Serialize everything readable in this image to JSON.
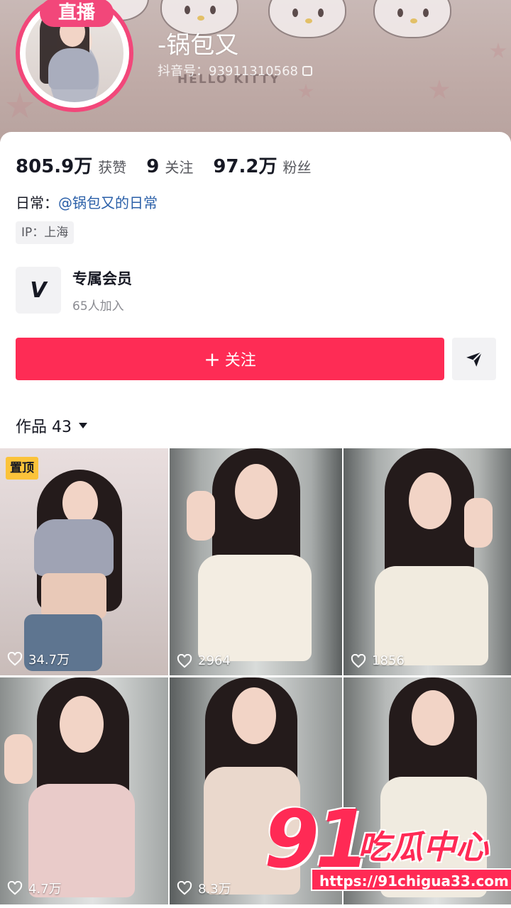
{
  "profile": {
    "live_badge": "直播",
    "username": "-锅包又",
    "douyin_id": "抖音号：93911310568",
    "banner_text": "HELLO KITTY"
  },
  "stats": [
    {
      "value": "805.9万",
      "label": "获赞"
    },
    {
      "value": "9",
      "label": "关注"
    },
    {
      "value": "97.2万",
      "label": "粉丝"
    }
  ],
  "bio": {
    "prefix": "日常：",
    "link": "@锅包又的日常"
  },
  "ip": "IP：上海",
  "member": {
    "icon_glyph": "V",
    "title": "专属会员",
    "subtitle": "65人加入"
  },
  "actions": {
    "follow_plus": "+",
    "follow_label": "关注",
    "share_icon": "send-icon"
  },
  "works_tab": {
    "label": "作品 43"
  },
  "videos": [
    {
      "pinned": "置顶",
      "likes": "34.7万"
    },
    {
      "likes": "2964"
    },
    {
      "likes": "1856"
    },
    {
      "likes": "4.7万"
    },
    {
      "likes": "8.3万"
    },
    {
      "likes": ""
    }
  ],
  "watermark": {
    "big": "91",
    "cn": "吃瓜中心",
    "url": "https://91chigua33.com"
  },
  "colors": {
    "accent": "#fe2c55",
    "live": "#f2477a",
    "link": "#2a5fa8",
    "pin": "#fbc33a"
  }
}
